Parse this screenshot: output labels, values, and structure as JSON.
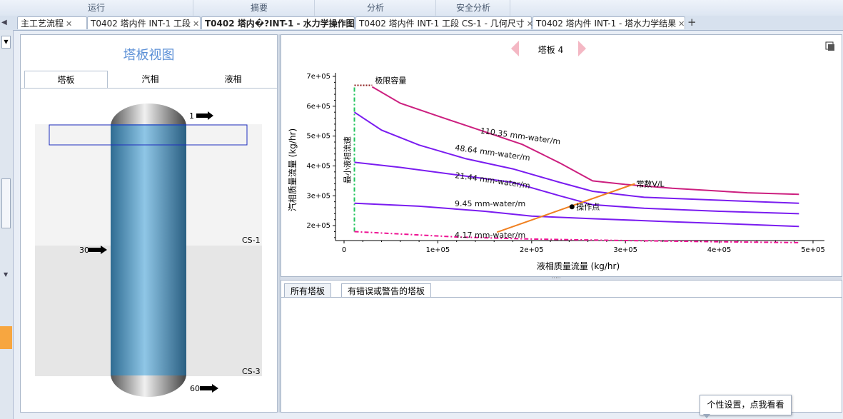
{
  "ribbon": {
    "items": [
      "运行",
      "摘要",
      "分析",
      "安全分析"
    ]
  },
  "tabs": [
    {
      "label": "主工艺流程",
      "active": false
    },
    {
      "label": "T0402 塔内件 INT-1 工段",
      "active": false
    },
    {
      "label": "T0402 塔内�?INT-1 - 水力学操作图",
      "active": true
    },
    {
      "label": "T0402 塔内件 INT-1 工段 CS-1 - 几何尺寸",
      "active": false
    },
    {
      "label": "T0402 塔内件 INT-1 - 塔水力学结果",
      "active": false
    }
  ],
  "tab_close": "✕",
  "tab_add": "+",
  "left_panel": {
    "title": "塔板视图",
    "subtabs": [
      "塔板",
      "汽相",
      "液相"
    ],
    "stage_labels": [
      "1",
      "30",
      "60"
    ],
    "section_labels": [
      "CS-1",
      "CS-3"
    ]
  },
  "tray_nav": {
    "label": "塔板 4"
  },
  "chart_data": {
    "type": "line",
    "xlabel": "液相质量流量 (kg/hr)",
    "ylabel": "汽相质量流量 (kg/hr)",
    "xlim": [
      0,
      500000
    ],
    "ylim": [
      150000,
      700000
    ],
    "xticks": [
      "0",
      "1e+05",
      "2e+05",
      "3e+05",
      "4e+05",
      "5e+05"
    ],
    "yticks": [
      "2e+05",
      "3e+05",
      "4e+05",
      "5e+05",
      "6e+05",
      "7e+05"
    ],
    "series": [
      {
        "name": "110.35 mm-water/m",
        "color": "#cc1f7f",
        "style": "solid",
        "points": [
          [
            30000,
            665000
          ],
          [
            60000,
            610000
          ],
          [
            100000,
            567000
          ],
          [
            140000,
            525000
          ],
          [
            190000,
            472000
          ],
          [
            230000,
            410000
          ],
          [
            265000,
            350000
          ],
          [
            300000,
            338000
          ],
          [
            350000,
            325000
          ],
          [
            430000,
            310000
          ],
          [
            485000,
            305000
          ]
        ]
      },
      {
        "name": "48.64 mm-water/m",
        "color": "#7a1cf0",
        "style": "solid",
        "points": [
          [
            11000,
            580000
          ],
          [
            40000,
            520000
          ],
          [
            80000,
            470000
          ],
          [
            130000,
            424000
          ],
          [
            180000,
            390000
          ],
          [
            230000,
            345000
          ],
          [
            265000,
            315000
          ],
          [
            320000,
            295000
          ],
          [
            400000,
            285000
          ],
          [
            485000,
            275000
          ]
        ]
      },
      {
        "name": "21.44 mm-water/m",
        "color": "#7a1cf0",
        "style": "solid",
        "points": [
          [
            11000,
            412000
          ],
          [
            60000,
            395000
          ],
          [
            120000,
            370000
          ],
          [
            180000,
            345000
          ],
          [
            230000,
            300000
          ],
          [
            265000,
            270000
          ],
          [
            320000,
            258000
          ],
          [
            400000,
            248000
          ],
          [
            485000,
            240000
          ]
        ]
      },
      {
        "name": "9.45 mm-water/m",
        "color": "#7a1cf0",
        "style": "solid",
        "points": [
          [
            11000,
            275000
          ],
          [
            80000,
            265000
          ],
          [
            150000,
            248000
          ],
          [
            200000,
            232000
          ],
          [
            260000,
            224000
          ],
          [
            340000,
            214000
          ],
          [
            420000,
            205000
          ],
          [
            485000,
            197000
          ]
        ]
      },
      {
        "name": "4.17 mm-water/m",
        "color": "#ee1193",
        "style": "dashdot",
        "points": [
          [
            11000,
            180000
          ],
          [
            60000,
            172000
          ],
          [
            120000,
            162000
          ],
          [
            200000,
            155000
          ],
          [
            300000,
            150000
          ],
          [
            400000,
            146000
          ],
          [
            485000,
            143000
          ]
        ]
      }
    ],
    "limit_lines": [
      {
        "name": "极限容量",
        "color": "#8b1a1a",
        "style": "dotted",
        "points": [
          [
            11000,
            670000
          ],
          [
            30000,
            670000
          ]
        ]
      },
      {
        "name": "最小液相流速",
        "color": "#22c55e",
        "style": "dashdot",
        "points": [
          [
            11000,
            180000
          ],
          [
            11000,
            670000
          ]
        ]
      }
    ],
    "operating_line": {
      "name": "常数V/L",
      "color": "#f08020",
      "points": [
        [
          163000,
          178000
        ],
        [
          240000,
          263000
        ],
        [
          310000,
          340000
        ]
      ]
    },
    "operating_point": {
      "name": "操作点",
      "x": 243000,
      "y": 263000
    },
    "label_positions": [
      {
        "series": "110.35 mm-water/m",
        "x": 145000,
        "y": 510000
      },
      {
        "series": "48.64 mm-water/m",
        "x": 118000,
        "y": 453000
      },
      {
        "series": "21.44 mm-water/m",
        "x": 118000,
        "y": 360000
      },
      {
        "series": "9.45 mm-water/m",
        "x": 118000,
        "y": 265000
      },
      {
        "series": "4.17 mm-water/m",
        "x": 118000,
        "y": 160000
      }
    ]
  },
  "bottom_tabs": [
    "所有塔板",
    "有错误或警告的塔板"
  ],
  "tooltip": "个性设置，点我看看"
}
